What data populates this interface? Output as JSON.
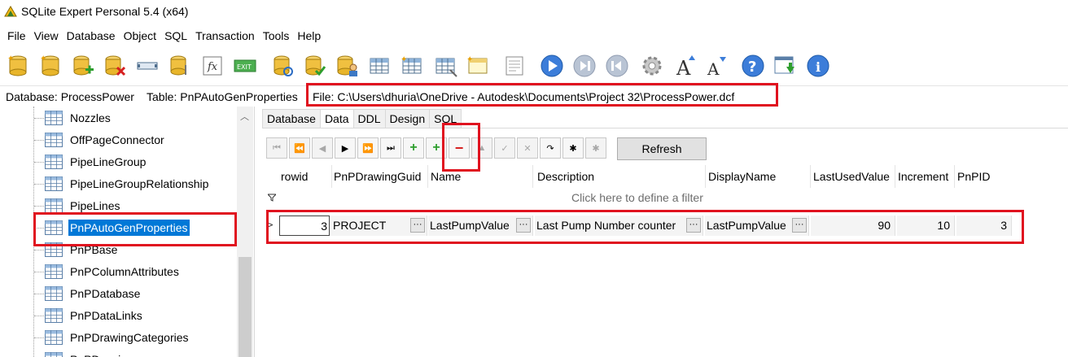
{
  "window": {
    "title": "SQLite Expert Personal 5.4 (x64)"
  },
  "menu": [
    "File",
    "View",
    "Database",
    "Object",
    "SQL",
    "Transaction",
    "Tools",
    "Help"
  ],
  "toolbar": {
    "icons": [
      "new-database-icon",
      "open-database-icon",
      "attach-database-icon",
      "detach-database-icon",
      "vacuum-icon",
      "open-file-icon",
      "function-icon",
      "exit-icon",
      "refresh-database-icon",
      "check-database-icon",
      "user-database-icon",
      "table-icon",
      "design-table-icon",
      "new-table-icon",
      "view-icon",
      "execute-icon",
      "stop-icon",
      "rewind-icon",
      "options-gear-icon",
      "increase-font-icon",
      "decrease-font-icon",
      "help-icon",
      "download-icon",
      "info-icon"
    ]
  },
  "infobar": {
    "database": "Database: ProcessPower",
    "table": "Table: PnPAutoGenProperties",
    "file": "File: C:\\Users\\dhuria\\OneDrive - Autodesk\\Documents\\Project 32\\ProcessPower.dcf"
  },
  "tree": {
    "items": [
      "Nozzles",
      "OffPageConnector",
      "PipeLineGroup",
      "PipeLineGroupRelationship",
      "PipeLines",
      "PnPAutoGenProperties",
      "PnPBase",
      "PnPColumnAttributes",
      "PnPDatabase",
      "PnPDataLinks",
      "PnPDrawingCategories",
      "PnPDrawings"
    ],
    "selected_index": 5
  },
  "tabs": [
    "Database",
    "Data",
    "DDL",
    "Design",
    "SQL"
  ],
  "active_tab": "Data",
  "data_toolbar": {
    "refresh_label": "Refresh"
  },
  "grid": {
    "columns": [
      "rowid",
      "PnPDrawingGuid",
      "Name",
      "Description",
      "DisplayName",
      "LastUsedValue",
      "Increment",
      "PnPID"
    ],
    "filter_hint": "Click here to define a filter",
    "rows": [
      {
        "rowid": "3",
        "PnPDrawingGuid": "PROJECT",
        "Name": "LastPumpValue",
        "Description": "Last Pump Number counter",
        "DisplayName": "LastPumpValue",
        "LastUsedValue": "90",
        "Increment": "10",
        "PnPID": "3"
      }
    ]
  },
  "colors": {
    "highlight_red": "#e0121f",
    "selection_blue": "#0078d7"
  }
}
